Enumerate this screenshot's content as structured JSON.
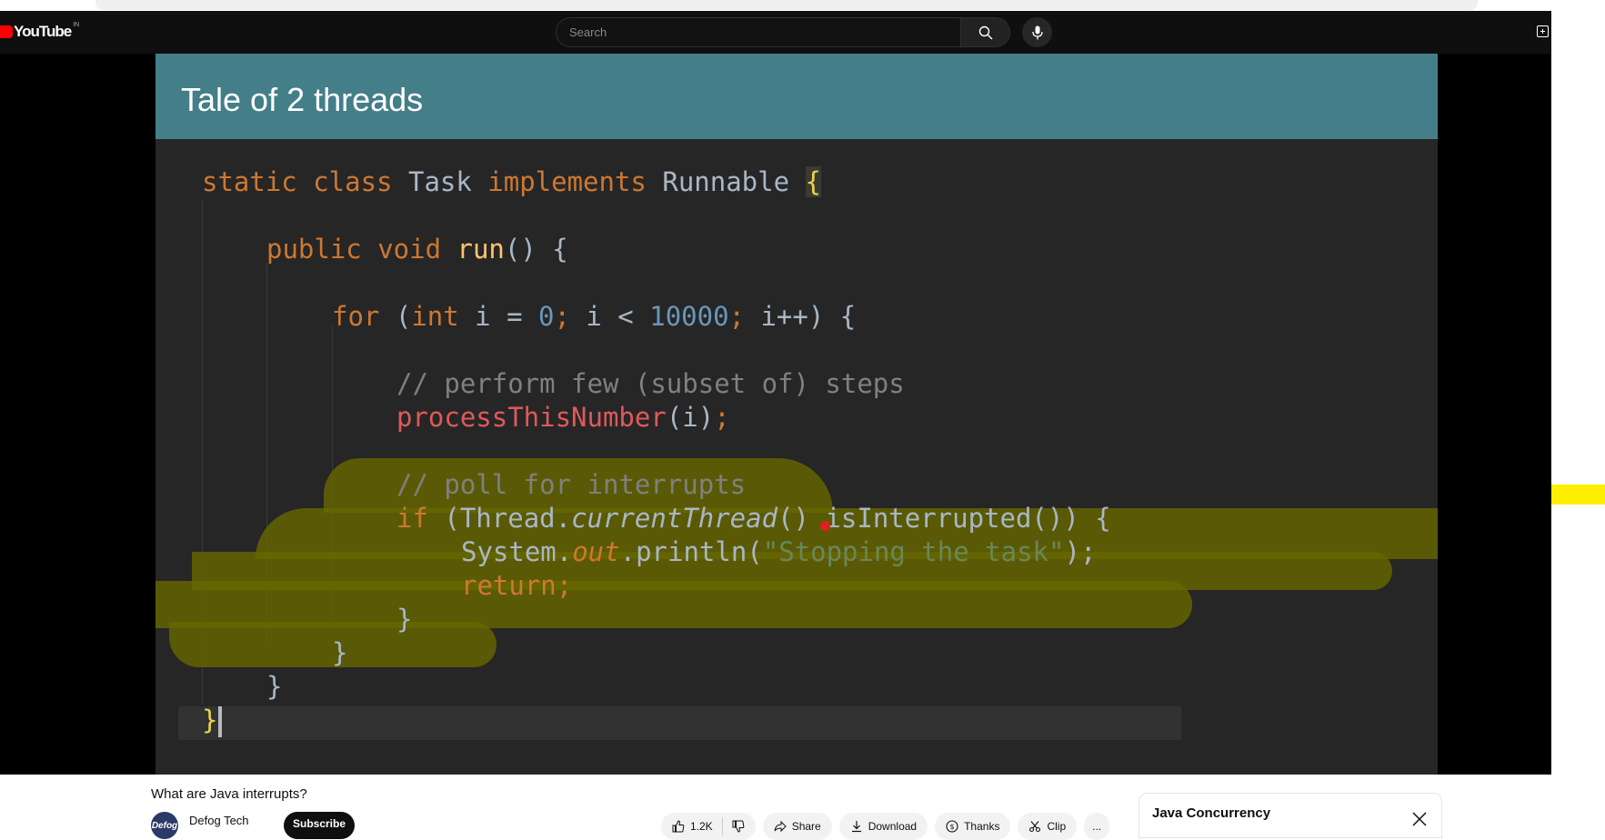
{
  "header": {
    "logo_text": "YouTube",
    "logo_country": "IN",
    "search_placeholder": "Search"
  },
  "slide": {
    "title": "Tale of 2 threads",
    "code": {
      "l1": {
        "kw": "static class ",
        "name": "Task ",
        "impl": "implements ",
        "iface": "Runnable ",
        "brace": "{"
      },
      "l2": {
        "kw": "public void ",
        "fn": "run",
        "rest": "() {"
      },
      "l3": {
        "kw_for": "for ",
        "p1": "(",
        "kw_int": "int ",
        "p2": "i = ",
        "n0": "0",
        "semi1": "; ",
        "p3": "i < ",
        "n1": "10000",
        "semi2": "; ",
        "p4": "i++) {"
      },
      "l4": {
        "comment": "// perform few (subset of) steps"
      },
      "l5": {
        "method": "processThisNumber",
        "args": "(i)",
        "semi": ";"
      },
      "l6": {
        "comment": "// poll for interrupts"
      },
      "l7": {
        "kw_if": "if ",
        "p1": "(Thread.",
        "call": "currentThread",
        "p2": "() isInterrupted()) {"
      },
      "l8": {
        "p1": "System.",
        "field": "out",
        "p2": ".println(",
        "str": "\"Stopping the task\"",
        "p3": ");"
      },
      "l9": {
        "kw": "return",
        "semi": ";"
      },
      "l10": {
        "brace": "}"
      },
      "l11": {
        "brace": "}"
      },
      "l12": {
        "brace": "}"
      },
      "l13": {
        "brace": "}"
      }
    }
  },
  "video": {
    "title": "What are Java interrupts?",
    "channel": "Defog Tech",
    "avatar_text": "Defog",
    "subscribe_label": "Subscribe",
    "like_count": "1.2K",
    "share_label": "Share",
    "download_label": "Download",
    "thanks_label": "Thanks",
    "clip_label": "Clip",
    "more_label": "..."
  },
  "playlist_panel": {
    "title": "Java Concurrency"
  },
  "colors": {
    "slide_title_bar": "#437e89",
    "code_bg": "#262626",
    "highlight": "#676600",
    "subscribe_bg": "#0f0f0f",
    "marker": "#ffee00"
  }
}
